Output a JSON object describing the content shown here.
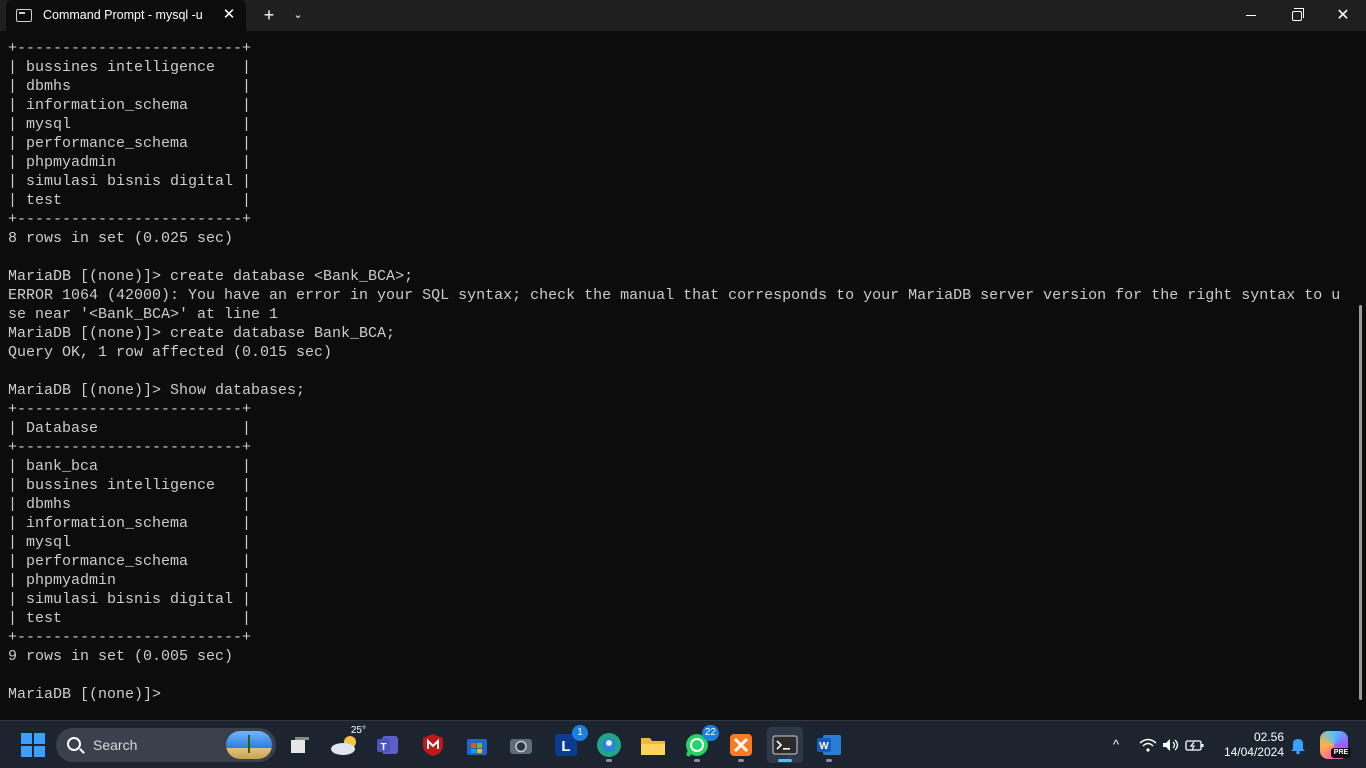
{
  "window": {
    "tab_title": "Command Prompt - mysql  -u",
    "close_glyph": "✕",
    "new_tab_glyph": "+",
    "dropdown_glyph": "⌄"
  },
  "terminal": {
    "lines": [
      "+-------------------------+",
      "| bussines intelligence   |",
      "| dbmhs                   |",
      "| information_schema      |",
      "| mysql                   |",
      "| performance_schema      |",
      "| phpmyadmin              |",
      "| simulasi bisnis digital |",
      "| test                    |",
      "+-------------------------+",
      "8 rows in set (0.025 sec)",
      "",
      "MariaDB [(none)]> create database <Bank_BCA>;",
      "ERROR 1064 (42000): You have an error in your SQL syntax; check the manual that corresponds to your MariaDB server version for the right syntax to u",
      "se near '<Bank_BCA>' at line 1",
      "MariaDB [(none)]> create database Bank_BCA;",
      "Query OK, 1 row affected (0.015 sec)",
      "",
      "MariaDB [(none)]> Show databases;",
      "+-------------------------+",
      "| Database                |",
      "+-------------------------+",
      "| bank_bca                |",
      "| bussines intelligence   |",
      "| dbmhs                   |",
      "| information_schema      |",
      "| mysql                   |",
      "| performance_schema      |",
      "| phpmyadmin              |",
      "| simulasi bisnis digital |",
      "| test                    |",
      "+-------------------------+",
      "9 rows in set (0.005 sec)",
      "",
      "MariaDB [(none)]>"
    ]
  },
  "taskbar": {
    "search_placeholder": "Search",
    "weather_temp": "25°",
    "apps": [
      {
        "id": "task-view",
        "badge": ""
      },
      {
        "id": "weather",
        "badge": ""
      },
      {
        "id": "teams",
        "badge": ""
      },
      {
        "id": "mcafee",
        "badge": ""
      },
      {
        "id": "microsoft-store",
        "badge": ""
      },
      {
        "id": "camera",
        "badge": ""
      },
      {
        "id": "l-app",
        "badge": "1"
      },
      {
        "id": "edge",
        "badge": ""
      },
      {
        "id": "file-explorer",
        "badge": ""
      },
      {
        "id": "whatsapp",
        "badge": "22"
      },
      {
        "id": "xampp",
        "badge": ""
      },
      {
        "id": "terminal",
        "badge": ""
      },
      {
        "id": "word",
        "badge": ""
      }
    ],
    "clock_time": "02.56",
    "clock_date": "14/04/2024",
    "copilot_label": "PRE"
  },
  "colors": {
    "terminal_bg": "#0c0c0c",
    "terminal_fg": "#cccccc",
    "accent": "#4cc2ff"
  }
}
